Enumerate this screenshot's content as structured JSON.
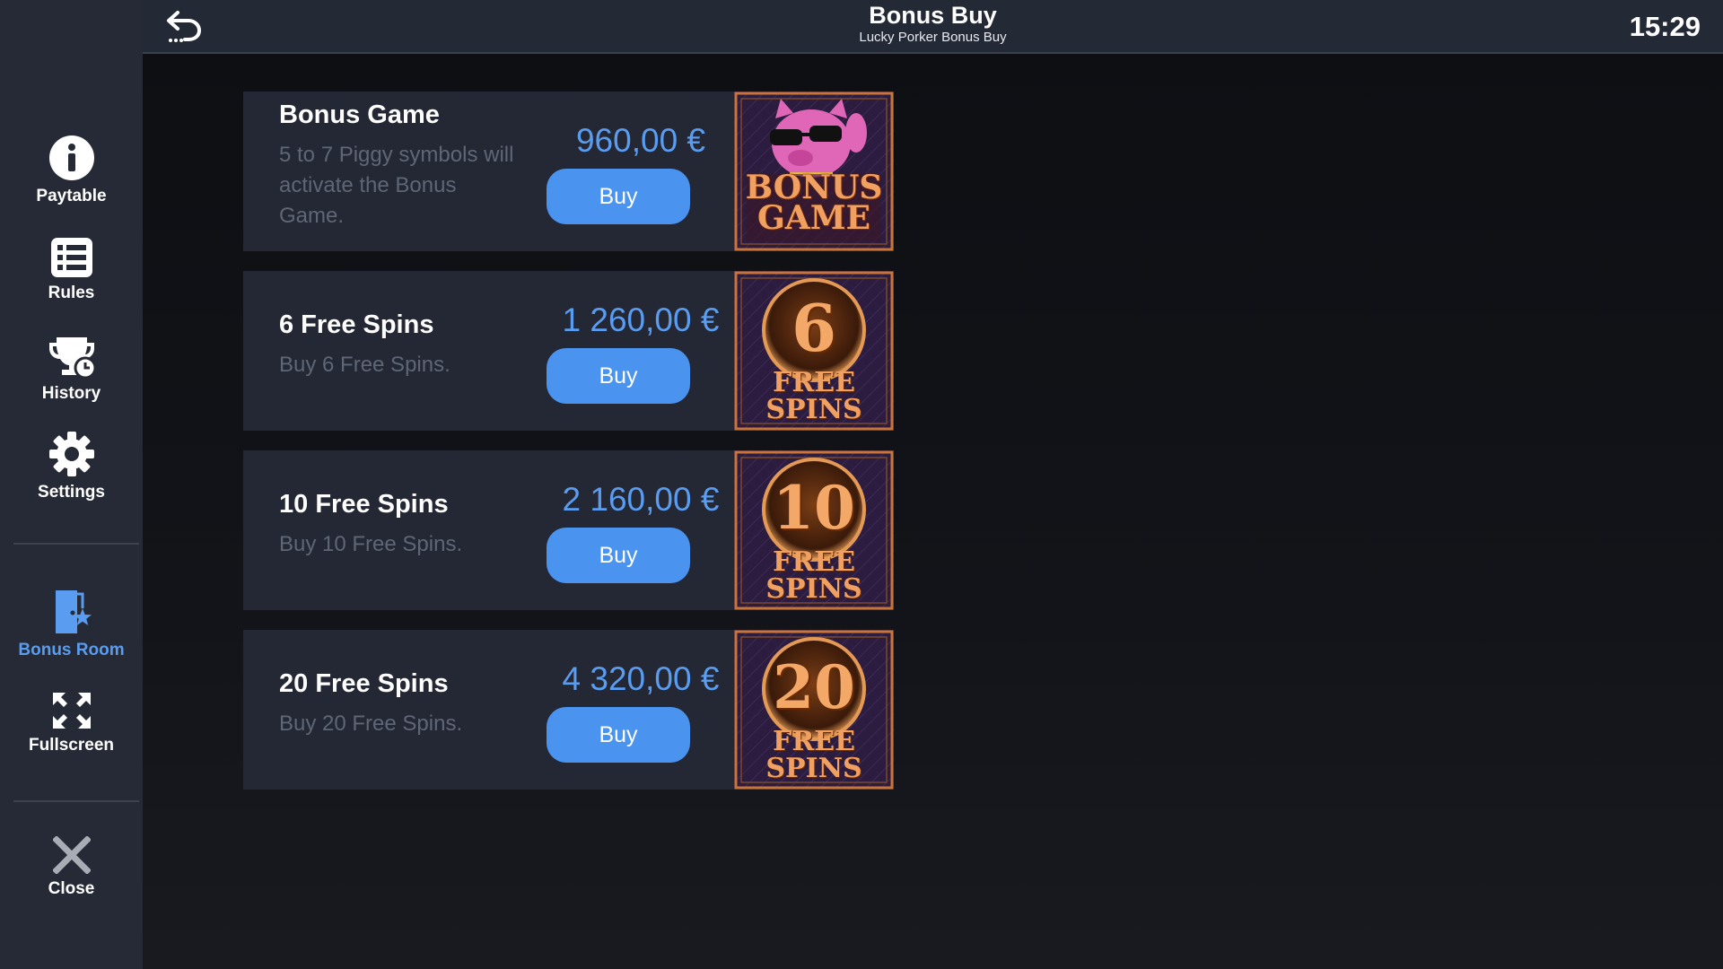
{
  "header": {
    "title": "Bonus Buy",
    "subtitle": "Lucky Porker Bonus Buy",
    "clock": "15:29"
  },
  "sidebar": {
    "items": [
      {
        "label": "Paytable",
        "icon": "info-icon"
      },
      {
        "label": "Rules",
        "icon": "list-icon"
      },
      {
        "label": "History",
        "icon": "trophy-clock-icon"
      },
      {
        "label": "Settings",
        "icon": "gear-icon"
      },
      {
        "label": "Bonus Room",
        "icon": "bonus-room-icon",
        "active": true
      },
      {
        "label": "Fullscreen",
        "icon": "fullscreen-icon"
      },
      {
        "label": "Close",
        "icon": "close-icon"
      }
    ]
  },
  "cards": [
    {
      "title": "Bonus Game",
      "desc": "5 to 7 Piggy symbols will activate the Bonus Game.",
      "price": "960,00 €",
      "buy": "Buy",
      "badge_top": "BONUS",
      "badge_bottom": "GAME"
    },
    {
      "title": "6 Free Spins",
      "desc": "Buy 6 Free Spins.",
      "price": "1 260,00 €",
      "buy": "Buy",
      "badge_num": "6",
      "badge_top": "FREE",
      "badge_bottom": "SPINS"
    },
    {
      "title": "10 Free Spins",
      "desc": "Buy 10 Free Spins.",
      "price": "2 160,00 €",
      "buy": "Buy",
      "badge_num": "10",
      "badge_top": "FREE",
      "badge_bottom": "SPINS"
    },
    {
      "title": "20 Free Spins",
      "desc": "Buy 20 Free Spins.",
      "price": "4 320,00 €",
      "buy": "Buy",
      "badge_num": "20",
      "badge_top": "FREE",
      "badge_bottom": "SPINS"
    }
  ],
  "colors": {
    "accent": "#4a93ef",
    "price": "#5a9cf0",
    "card": "#242835",
    "sidebar": "#252a36"
  }
}
